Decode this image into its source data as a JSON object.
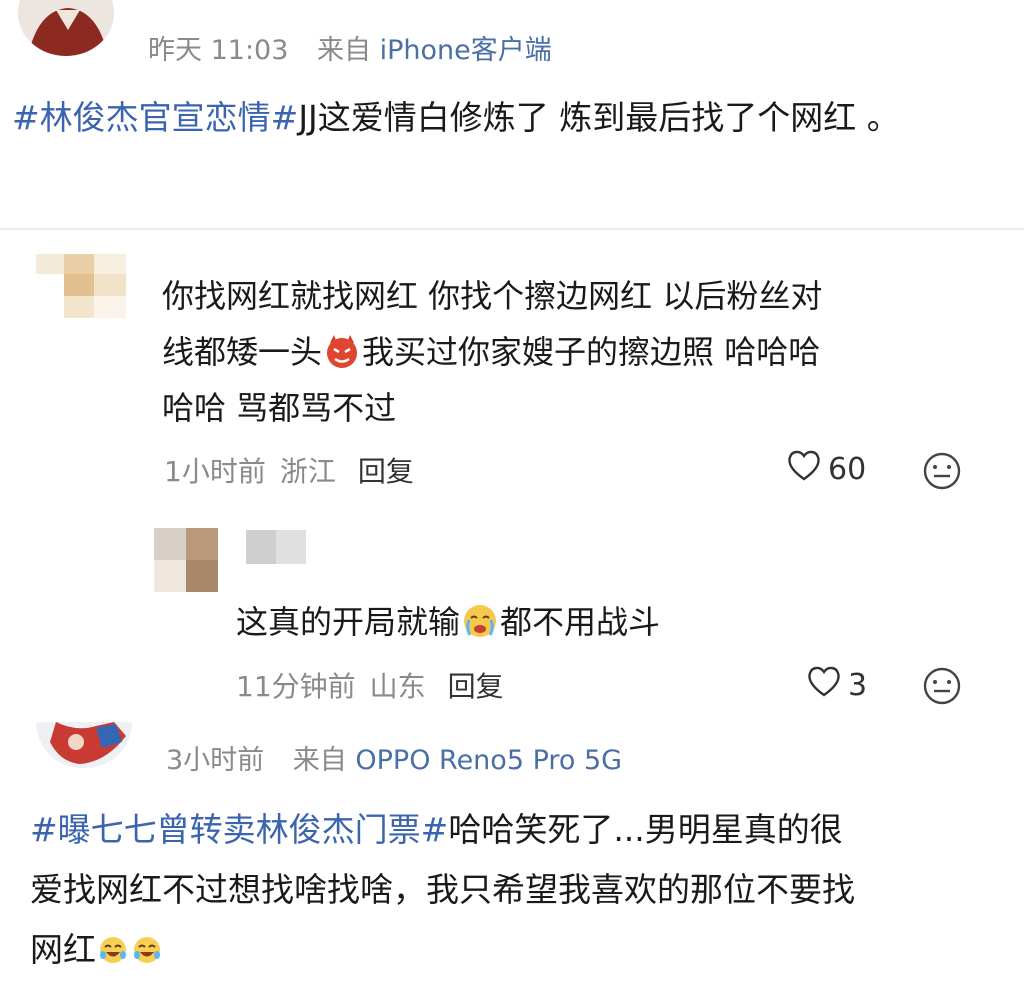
{
  "post1": {
    "time": "昨天 11:03",
    "source_prefix": "来自",
    "client": "iPhone客户端",
    "hashtag": "#林俊杰官宣恋情#",
    "text": "JJ这爱情白修炼了 炼到最后找了个网红 。"
  },
  "comment1": {
    "line1": "你找网红就找网红 你找个擦边网红 以后粉丝对",
    "line2a": "线都矮一头",
    "line2_emoji": "devil-emoji",
    "line2b": "我买过你家嫂子的擦边照 哈哈哈",
    "line3": "哈哈 骂都骂不过",
    "time": "1小时前",
    "location": "浙江",
    "reply_label": "回复",
    "likes": "60"
  },
  "comment2": {
    "text_a": "这真的开局就输",
    "text_emoji": "crying-face-emoji",
    "text_b": "都不用战斗",
    "time": "11分钟前",
    "location": "山东",
    "reply_label": "回复",
    "likes": "3"
  },
  "post2": {
    "time": "3小时前",
    "source_prefix": "来自",
    "client": "OPPO Reno5 Pro 5G",
    "hashtag": "#曝七七曾转卖林俊杰门票#",
    "text_line1": "哈哈笑死了...男明星真的很",
    "text_line2": "爱找网红不过想找啥找啥，我只希望我喜欢的那位不要找",
    "text_line3": "网红",
    "end_emojis": [
      "laughing-tears-emoji",
      "laughing-tears-emoji"
    ]
  },
  "colors": {
    "link": "#3a64b0",
    "meta": "#8a8a8a",
    "text": "#1a1a1a"
  }
}
